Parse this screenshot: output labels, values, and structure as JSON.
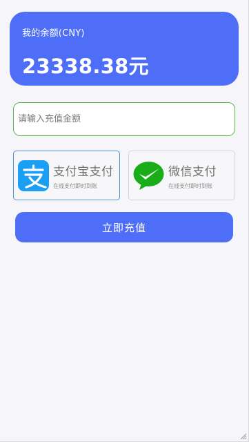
{
  "balance": {
    "label": "我的余额(CNY)",
    "amount": "23338.38元"
  },
  "amount_input": {
    "placeholder": "请输入充值金额",
    "value": ""
  },
  "payment_methods": [
    {
      "name": "支付宝支付",
      "subtitle": "在线支付即时到账",
      "icon": "alipay-icon",
      "selected": true
    },
    {
      "name": "微信支付",
      "subtitle": "在线支付即时到账",
      "icon": "wechat-pay-icon",
      "selected": false
    }
  ],
  "submit_label": "立即充值",
  "colors": {
    "primary": "#4f6ef7",
    "alipay_blue": "#1a9ff5",
    "wechat_green": "#1aad19",
    "input_border": "#57b84a"
  }
}
